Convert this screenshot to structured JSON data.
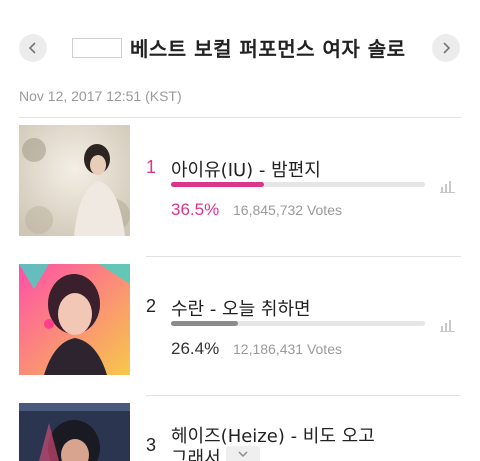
{
  "header": {
    "title": "베스트 보컬 퍼포먼스 여자 솔로",
    "date": "Nov 12, 2017 12:51 (KST)"
  },
  "colors": {
    "accent": "#d9368c",
    "secondary_bar": "#8c8c8c",
    "muted_text": "#9a9a9a"
  },
  "items": [
    {
      "rank": "1",
      "song": "아이유(IU) - 밤편지",
      "percent": "36.5%",
      "share": 0.365,
      "votes": "16,845,732 Votes"
    },
    {
      "rank": "2",
      "song": "수란 - 오늘 취하면",
      "percent": "26.4%",
      "share": 0.264,
      "votes": "12,186,431 Votes"
    },
    {
      "rank": "3",
      "song": "헤이즈(Heize) - 비도 오고",
      "song_line2": "그래서"
    }
  ]
}
